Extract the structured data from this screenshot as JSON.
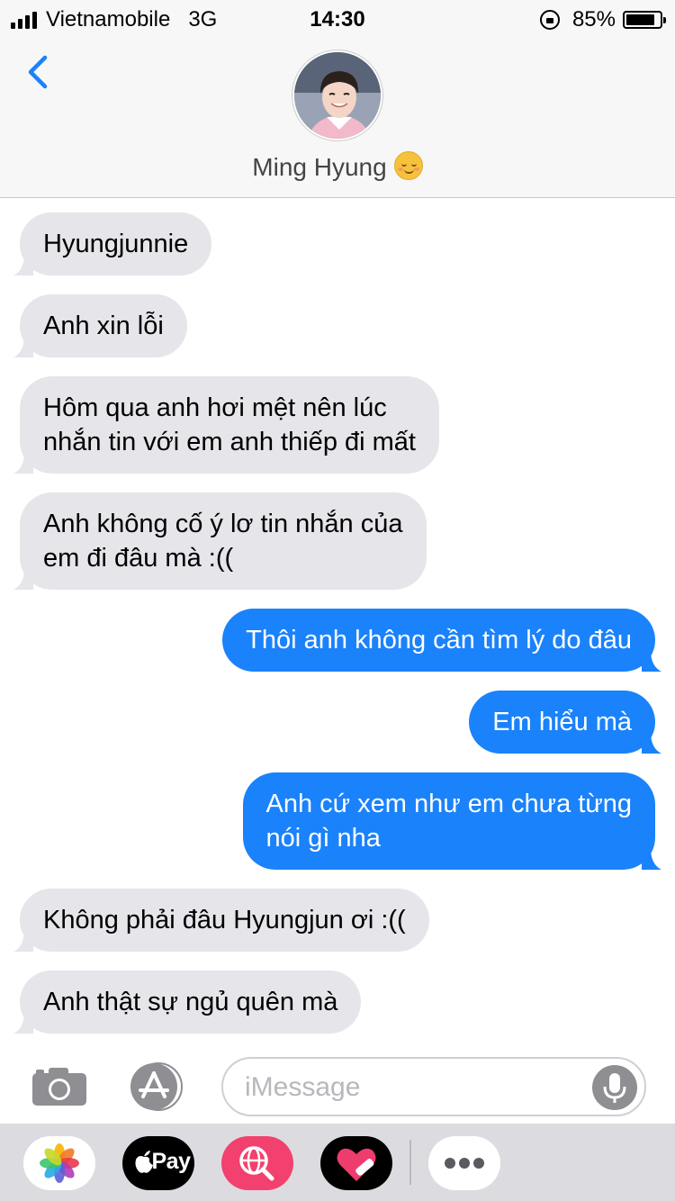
{
  "status_bar": {
    "carrier": "Vietnamobile",
    "network": "3G",
    "time": "14:30",
    "battery": "85%",
    "battery_level": 0.85
  },
  "header": {
    "contact_name": "Ming Hyung"
  },
  "messages": [
    {
      "direction": "in",
      "lines": [
        "Hyungjunnie"
      ]
    },
    {
      "direction": "in",
      "lines": [
        "Anh xin lỗi"
      ]
    },
    {
      "direction": "in",
      "lines": [
        "Hôm qua anh hơi mệt nên lúc",
        "nhắn tin với em anh thiếp đi mất"
      ]
    },
    {
      "direction": "in",
      "lines": [
        "Anh không cố ý lơ tin nhắn của",
        "em đi đâu mà :(("
      ]
    },
    {
      "direction": "out",
      "lines": [
        "Thôi anh không cần tìm lý do đâu"
      ]
    },
    {
      "direction": "out",
      "lines": [
        "Em hiểu mà"
      ]
    },
    {
      "direction": "out",
      "lines": [
        "Anh cứ xem như em chưa từng",
        "nói gì nha"
      ]
    },
    {
      "direction": "in",
      "lines": [
        "Không phải đâu Hyungjun ơi :(("
      ]
    },
    {
      "direction": "in",
      "lines": [
        "Anh thật sự ngủ quên mà"
      ]
    }
  ],
  "input": {
    "placeholder": "iMessage",
    "value": ""
  },
  "app_drawer": {
    "apple_pay_label": "Pay"
  },
  "colors": {
    "incoming_bubble": "#e5e5ea",
    "outgoing_bubble": "#1a82fb",
    "accent": "#1a82fb"
  }
}
